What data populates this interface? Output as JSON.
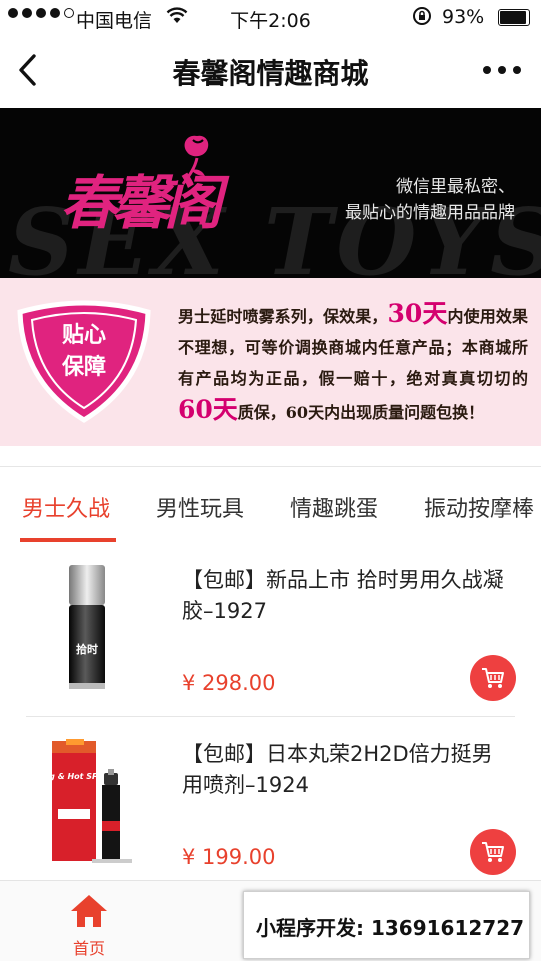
{
  "status_bar": {
    "carrier": "中国电信",
    "time": "下午2:06",
    "battery": "93%"
  },
  "nav": {
    "title": "春馨阁情趣商城"
  },
  "banner": {
    "logo": "春馨阁",
    "slogan_line1": "微信里最私密、",
    "slogan_line2": "最贴心的情趣用品品牌",
    "background_text": "SEX TOYS"
  },
  "guarantee": {
    "badge_line1": "贴心",
    "badge_line2": "保障",
    "text_1": "男士延时喷雾系列，保效果，",
    "highlight_1": "30天",
    "text_2": "内使用效果不理想，可等价调换商城内任意产品；本商城所有产品均为正品，假一赔十，绝对真真切切的",
    "highlight_2": "60天",
    "text_3": "质保，60天内出现质量问题包换！"
  },
  "tabs": [
    {
      "label": "男士久战",
      "active": true
    },
    {
      "label": "男性玩具",
      "active": false
    },
    {
      "label": "情趣跳蛋",
      "active": false
    },
    {
      "label": "振动按摩棒",
      "active": false
    }
  ],
  "products": [
    {
      "name": "【包邮】新品上市 拾时男用久战凝胶–1927",
      "price": "¥ 298.00",
      "image_label": "拾时"
    },
    {
      "name": "【包邮】日本丸荣2H2D倍力挺男用喷剂–1924",
      "price": "¥ 199.00",
      "image_label": "Long & Hot SPRAY"
    }
  ],
  "tabbar": {
    "home_label": "首页"
  },
  "dev_card": {
    "text": "小程序开发: 13691612727"
  },
  "colors": {
    "accent": "#e8412d",
    "brand_pink": "#e0237f",
    "banner_bg": "#050505",
    "guarantee_bg": "#fbe4ea"
  }
}
